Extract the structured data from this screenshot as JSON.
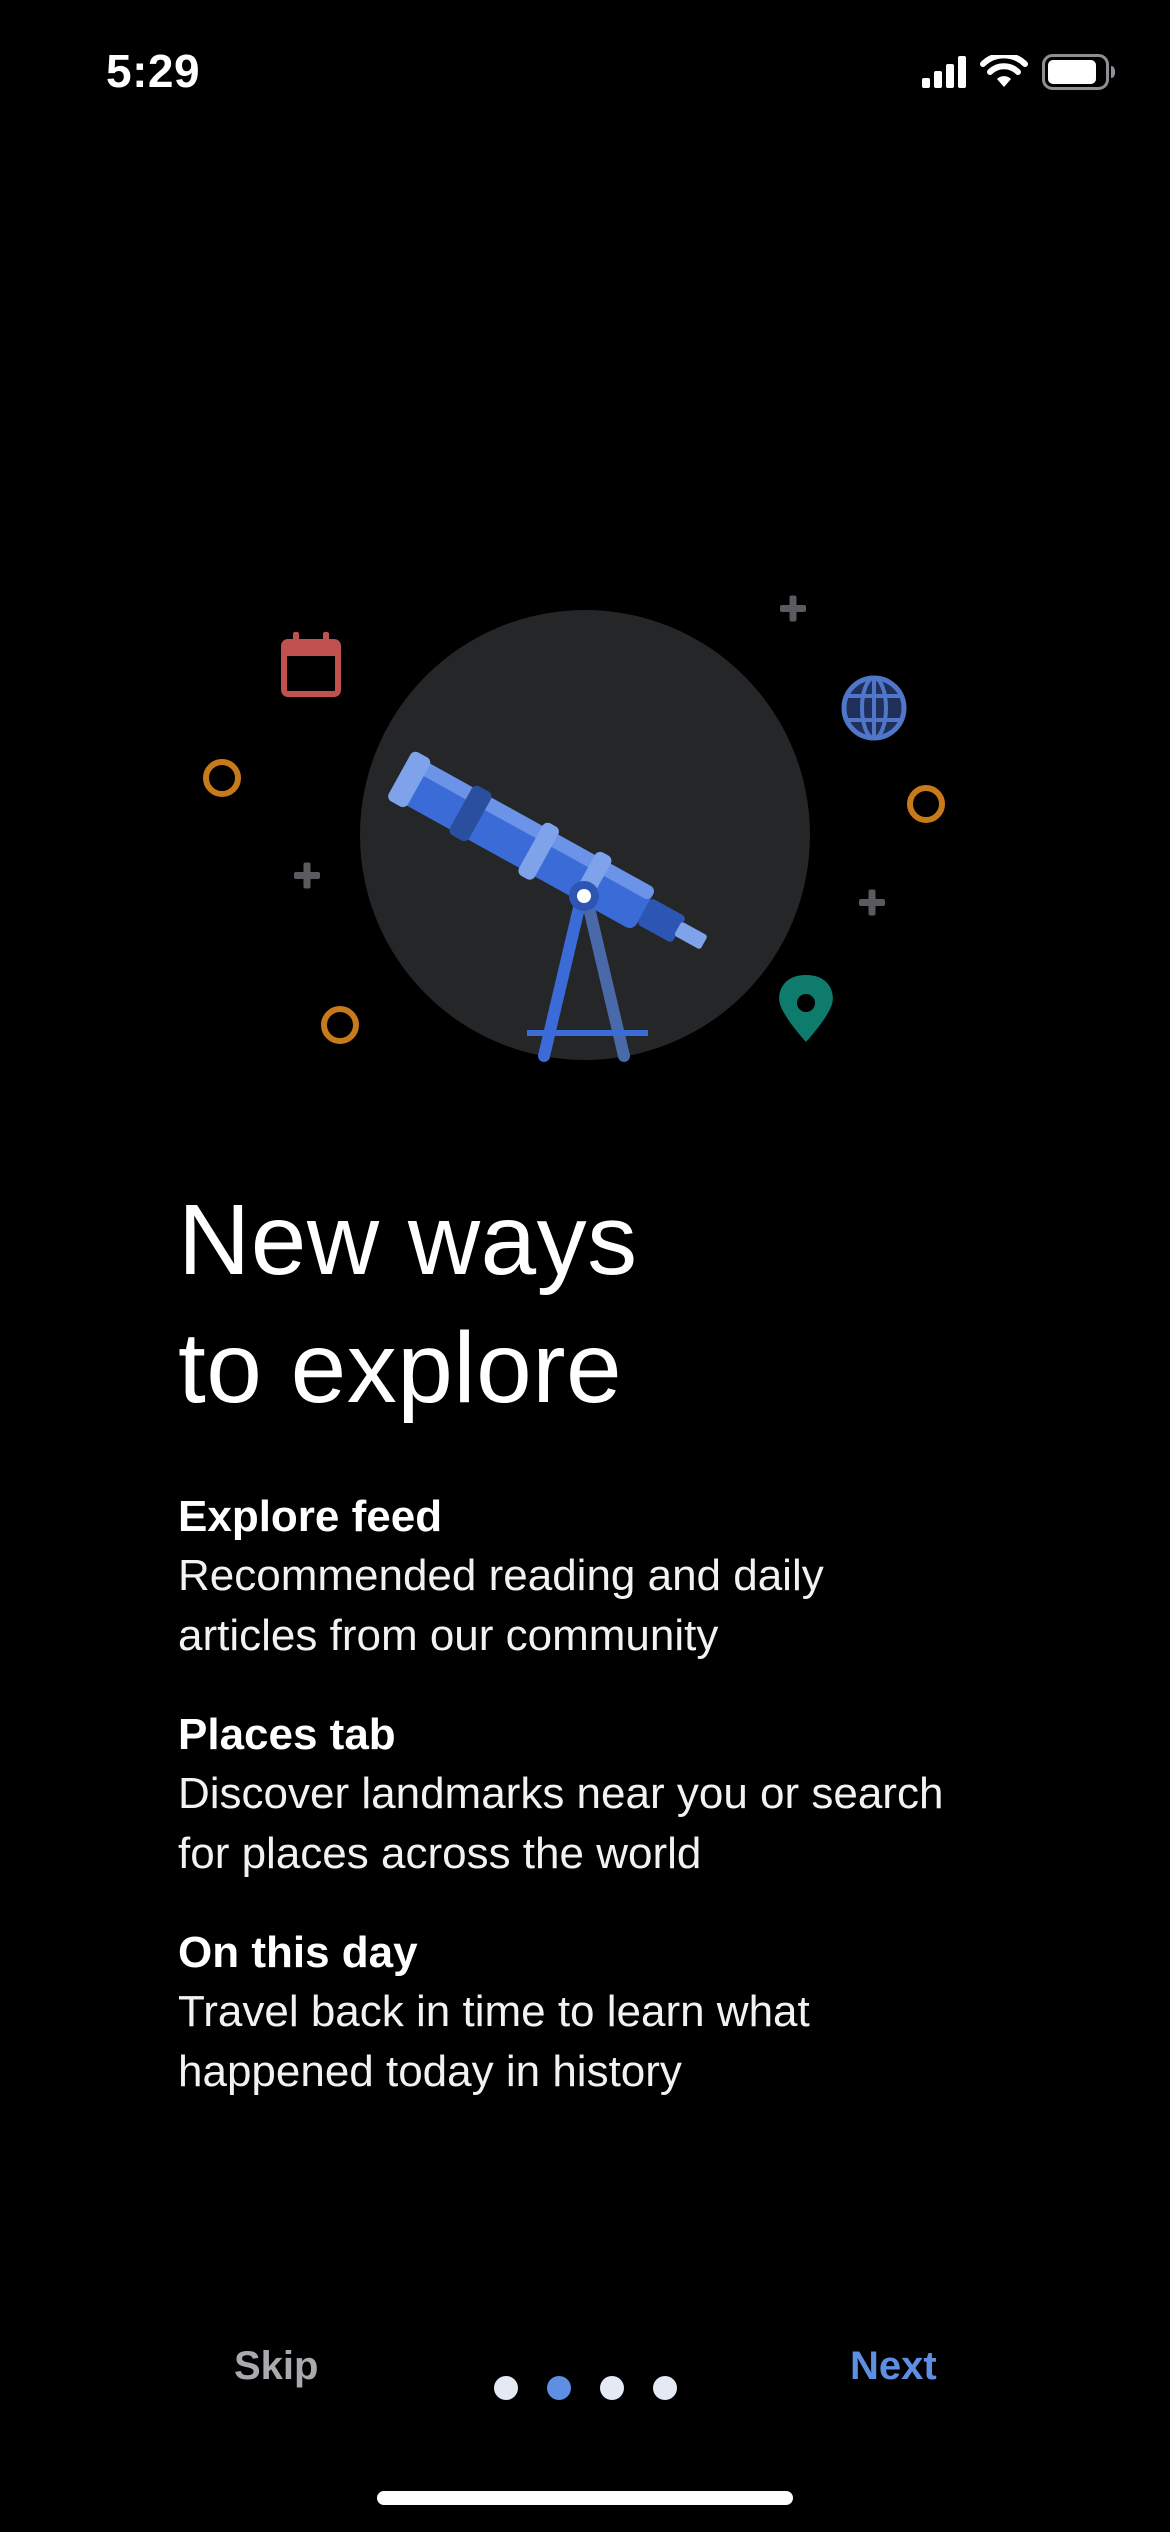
{
  "status_bar": {
    "time": "5:29"
  },
  "onboarding": {
    "title_line1": "New ways",
    "title_line2": "to explore",
    "features": [
      {
        "title": "Explore feed",
        "description_line1": "Recommended reading and daily",
        "description_line2": "articles from our community"
      },
      {
        "title": "Places tab",
        "description_line1": "Discover landmarks near you or search",
        "description_line2": "for places across the world"
      },
      {
        "title": "On this day",
        "description_line1": "Travel back in time to learn what",
        "description_line2": "happened today in history"
      }
    ]
  },
  "navigation": {
    "skip_label": "Skip",
    "next_label": "Next",
    "page_count": 4,
    "active_page": 2
  },
  "colors": {
    "background": "#000000",
    "accent": "#5e8fe3",
    "skip_text": "#a9a9ae",
    "circle": "#252628",
    "calendar": "#c0514f",
    "ring": "#c77a1a",
    "pin": "#0f7b6c",
    "globe": "#4f76c9"
  },
  "icons": [
    "signal-icon",
    "wifi-icon",
    "battery-icon",
    "telescope-icon",
    "calendar-icon",
    "globe-icon",
    "map-pin-icon"
  ]
}
